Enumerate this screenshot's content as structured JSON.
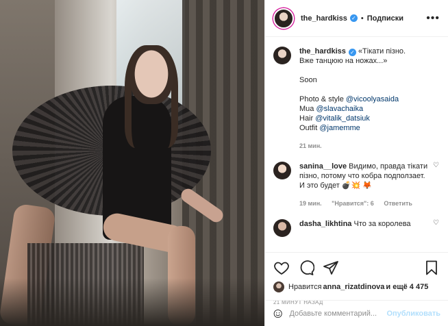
{
  "header": {
    "username": "the_hardkiss",
    "dot": "•",
    "follow_label": "Подписки",
    "more_label": "•••"
  },
  "caption": {
    "username": "the_hardkiss",
    "line1": "«Тікати пізно.",
    "line2": "Вже танцюю на ножах...»",
    "line3": "Soon",
    "photo_label": "Photo & style ",
    "photo_link": "@vicoolyasaida",
    "mua_label": "Mua ",
    "mua_link": "@slavachaika",
    "hair_label": "Hair ",
    "hair_link": "@vitalik_datsiuk",
    "outfit_label": "Outfit ",
    "outfit_link": "@jamemme",
    "time": "21 мин."
  },
  "comments": [
    {
      "username": "sanina__love",
      "text": "Видимо, правда тікати пізно, потому что кобра подползает. И это будет 💣💥 🦊",
      "time": "19 мин.",
      "likes": "\"Нравится\": 6",
      "reply": "Ответить"
    },
    {
      "username": "dasha_likhtina",
      "text": "Что за королева"
    }
  ],
  "likes": {
    "prefix": "Нравится ",
    "user": "anna_rizatdinova",
    "suffix": " и ещё 4 475"
  },
  "ago": "21 МИНУТ НАЗАД",
  "add_comment": {
    "placeholder": "Добавьте комментарий...",
    "publish_label": "Опубликовать"
  },
  "colors": {
    "accent": "#3897f0",
    "publish_disabled": "#b2dffc",
    "story_ring": "#d6249f"
  }
}
